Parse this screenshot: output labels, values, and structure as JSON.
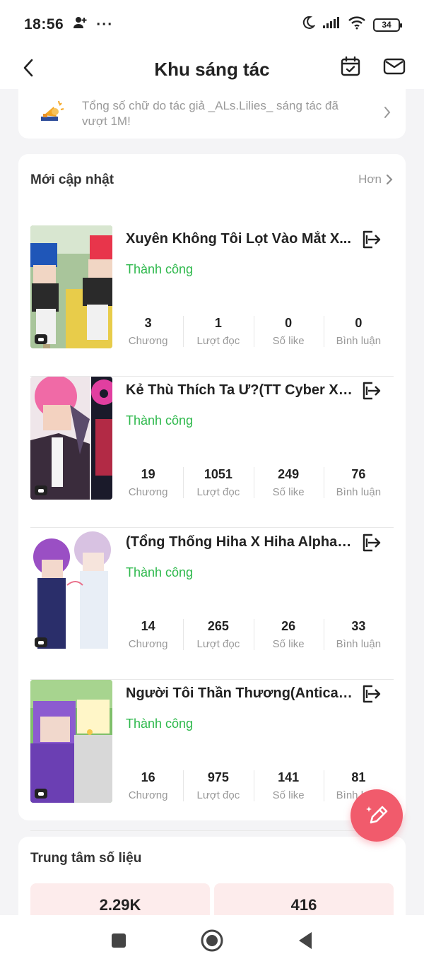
{
  "status_bar": {
    "time": "18:56",
    "battery": "34"
  },
  "header": {
    "title": "Khu sáng tác"
  },
  "notice": {
    "text": "Tổng số chữ do tác giả _ALs.Lilies_ sáng tác đã vượt 1M!"
  },
  "updates": {
    "heading": "Mới cập nhật",
    "more_label": "Hơn",
    "stat_labels": [
      "Chương",
      "Lượt đọc",
      "Số like",
      "Bình luận"
    ],
    "stories": [
      {
        "title": "Xuyên Không Tôi Lọt Vào Mắt X...",
        "status": "Thành công",
        "stats": [
          "3",
          "1",
          "0",
          "0"
        ]
      },
      {
        "title": "Kẻ Thù Thích Ta Ư?(TT Cyber X ...",
        "status": "Thành công",
        "stats": [
          "19",
          "1051",
          "249",
          "76"
        ]
      },
      {
        "title": "(Tổng Thống Hiha X Hiha Alpha)...",
        "status": "Thành công",
        "stats": [
          "14",
          "265",
          "26",
          "33"
        ]
      },
      {
        "title": "Người Tôi Thần Thương(Anticat...",
        "status": "Thành công",
        "stats": [
          "16",
          "975",
          "141",
          "81"
        ]
      }
    ]
  },
  "data_center": {
    "heading": "Trung tâm số liệu",
    "values": [
      "2.29K",
      "416"
    ]
  },
  "colors": {
    "accent": "#f15b6c",
    "success": "#2db84b"
  }
}
